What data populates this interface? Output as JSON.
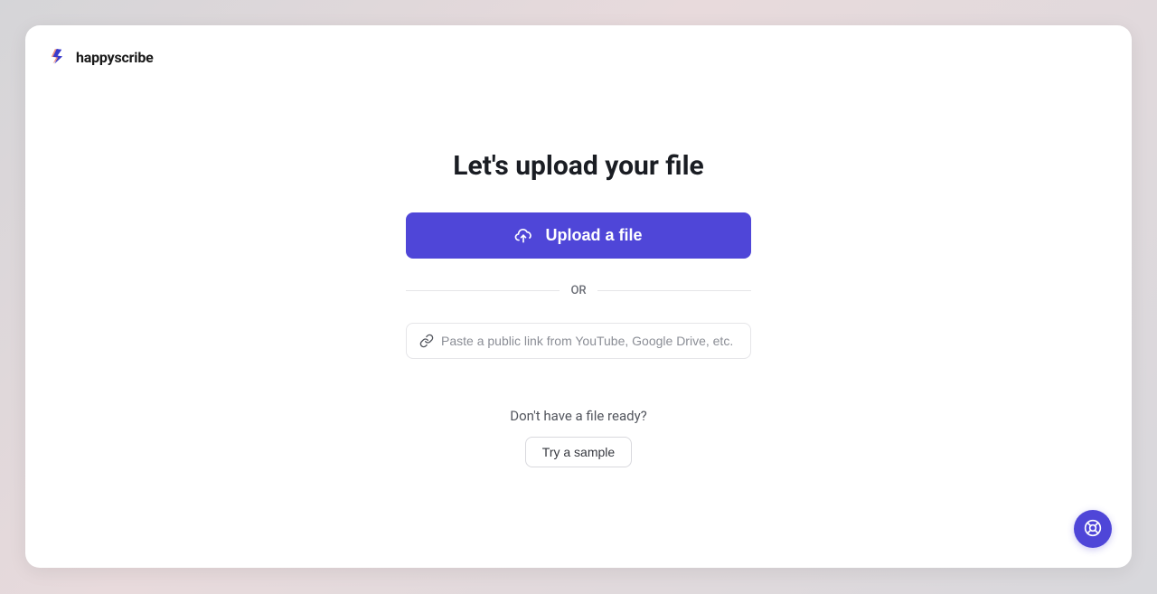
{
  "brand": {
    "name": "happyscribe"
  },
  "main": {
    "title": "Let's upload your file",
    "upload_button_label": "Upload a file",
    "divider_label": "OR",
    "link_placeholder": "Paste a public link from YouTube, Google Drive, etc.",
    "no_file_prompt": "Don't have a file ready?",
    "sample_button_label": "Try a sample"
  },
  "colors": {
    "primary": "#4f46d8",
    "text_dark": "#1a1d23",
    "text_muted": "#52555d"
  }
}
